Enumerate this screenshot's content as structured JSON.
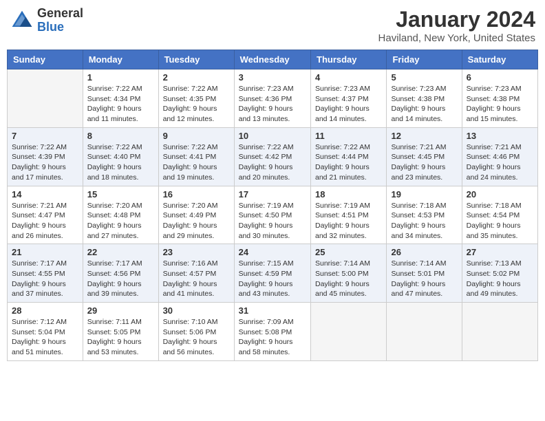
{
  "header": {
    "logo_general": "General",
    "logo_blue": "Blue",
    "month_title": "January 2024",
    "location": "Haviland, New York, United States"
  },
  "weekdays": [
    "Sunday",
    "Monday",
    "Tuesday",
    "Wednesday",
    "Thursday",
    "Friday",
    "Saturday"
  ],
  "weeks": [
    [
      {
        "day": "",
        "empty": true
      },
      {
        "day": "1",
        "sunrise": "Sunrise: 7:22 AM",
        "sunset": "Sunset: 4:34 PM",
        "daylight": "Daylight: 9 hours and 11 minutes."
      },
      {
        "day": "2",
        "sunrise": "Sunrise: 7:22 AM",
        "sunset": "Sunset: 4:35 PM",
        "daylight": "Daylight: 9 hours and 12 minutes."
      },
      {
        "day": "3",
        "sunrise": "Sunrise: 7:23 AM",
        "sunset": "Sunset: 4:36 PM",
        "daylight": "Daylight: 9 hours and 13 minutes."
      },
      {
        "day": "4",
        "sunrise": "Sunrise: 7:23 AM",
        "sunset": "Sunset: 4:37 PM",
        "daylight": "Daylight: 9 hours and 14 minutes."
      },
      {
        "day": "5",
        "sunrise": "Sunrise: 7:23 AM",
        "sunset": "Sunset: 4:38 PM",
        "daylight": "Daylight: 9 hours and 14 minutes."
      },
      {
        "day": "6",
        "sunrise": "Sunrise: 7:23 AM",
        "sunset": "Sunset: 4:38 PM",
        "daylight": "Daylight: 9 hours and 15 minutes."
      }
    ],
    [
      {
        "day": "7",
        "sunrise": "Sunrise: 7:22 AM",
        "sunset": "Sunset: 4:39 PM",
        "daylight": "Daylight: 9 hours and 17 minutes."
      },
      {
        "day": "8",
        "sunrise": "Sunrise: 7:22 AM",
        "sunset": "Sunset: 4:40 PM",
        "daylight": "Daylight: 9 hours and 18 minutes."
      },
      {
        "day": "9",
        "sunrise": "Sunrise: 7:22 AM",
        "sunset": "Sunset: 4:41 PM",
        "daylight": "Daylight: 9 hours and 19 minutes."
      },
      {
        "day": "10",
        "sunrise": "Sunrise: 7:22 AM",
        "sunset": "Sunset: 4:42 PM",
        "daylight": "Daylight: 9 hours and 20 minutes."
      },
      {
        "day": "11",
        "sunrise": "Sunrise: 7:22 AM",
        "sunset": "Sunset: 4:44 PM",
        "daylight": "Daylight: 9 hours and 21 minutes."
      },
      {
        "day": "12",
        "sunrise": "Sunrise: 7:21 AM",
        "sunset": "Sunset: 4:45 PM",
        "daylight": "Daylight: 9 hours and 23 minutes."
      },
      {
        "day": "13",
        "sunrise": "Sunrise: 7:21 AM",
        "sunset": "Sunset: 4:46 PM",
        "daylight": "Daylight: 9 hours and 24 minutes."
      }
    ],
    [
      {
        "day": "14",
        "sunrise": "Sunrise: 7:21 AM",
        "sunset": "Sunset: 4:47 PM",
        "daylight": "Daylight: 9 hours and 26 minutes."
      },
      {
        "day": "15",
        "sunrise": "Sunrise: 7:20 AM",
        "sunset": "Sunset: 4:48 PM",
        "daylight": "Daylight: 9 hours and 27 minutes."
      },
      {
        "day": "16",
        "sunrise": "Sunrise: 7:20 AM",
        "sunset": "Sunset: 4:49 PM",
        "daylight": "Daylight: 9 hours and 29 minutes."
      },
      {
        "day": "17",
        "sunrise": "Sunrise: 7:19 AM",
        "sunset": "Sunset: 4:50 PM",
        "daylight": "Daylight: 9 hours and 30 minutes."
      },
      {
        "day": "18",
        "sunrise": "Sunrise: 7:19 AM",
        "sunset": "Sunset: 4:51 PM",
        "daylight": "Daylight: 9 hours and 32 minutes."
      },
      {
        "day": "19",
        "sunrise": "Sunrise: 7:18 AM",
        "sunset": "Sunset: 4:53 PM",
        "daylight": "Daylight: 9 hours and 34 minutes."
      },
      {
        "day": "20",
        "sunrise": "Sunrise: 7:18 AM",
        "sunset": "Sunset: 4:54 PM",
        "daylight": "Daylight: 9 hours and 35 minutes."
      }
    ],
    [
      {
        "day": "21",
        "sunrise": "Sunrise: 7:17 AM",
        "sunset": "Sunset: 4:55 PM",
        "daylight": "Daylight: 9 hours and 37 minutes."
      },
      {
        "day": "22",
        "sunrise": "Sunrise: 7:17 AM",
        "sunset": "Sunset: 4:56 PM",
        "daylight": "Daylight: 9 hours and 39 minutes."
      },
      {
        "day": "23",
        "sunrise": "Sunrise: 7:16 AM",
        "sunset": "Sunset: 4:57 PM",
        "daylight": "Daylight: 9 hours and 41 minutes."
      },
      {
        "day": "24",
        "sunrise": "Sunrise: 7:15 AM",
        "sunset": "Sunset: 4:59 PM",
        "daylight": "Daylight: 9 hours and 43 minutes."
      },
      {
        "day": "25",
        "sunrise": "Sunrise: 7:14 AM",
        "sunset": "Sunset: 5:00 PM",
        "daylight": "Daylight: 9 hours and 45 minutes."
      },
      {
        "day": "26",
        "sunrise": "Sunrise: 7:14 AM",
        "sunset": "Sunset: 5:01 PM",
        "daylight": "Daylight: 9 hours and 47 minutes."
      },
      {
        "day": "27",
        "sunrise": "Sunrise: 7:13 AM",
        "sunset": "Sunset: 5:02 PM",
        "daylight": "Daylight: 9 hours and 49 minutes."
      }
    ],
    [
      {
        "day": "28",
        "sunrise": "Sunrise: 7:12 AM",
        "sunset": "Sunset: 5:04 PM",
        "daylight": "Daylight: 9 hours and 51 minutes."
      },
      {
        "day": "29",
        "sunrise": "Sunrise: 7:11 AM",
        "sunset": "Sunset: 5:05 PM",
        "daylight": "Daylight: 9 hours and 53 minutes."
      },
      {
        "day": "30",
        "sunrise": "Sunrise: 7:10 AM",
        "sunset": "Sunset: 5:06 PM",
        "daylight": "Daylight: 9 hours and 56 minutes."
      },
      {
        "day": "31",
        "sunrise": "Sunrise: 7:09 AM",
        "sunset": "Sunset: 5:08 PM",
        "daylight": "Daylight: 9 hours and 58 minutes."
      },
      {
        "day": "",
        "empty": true
      },
      {
        "day": "",
        "empty": true
      },
      {
        "day": "",
        "empty": true
      }
    ]
  ]
}
